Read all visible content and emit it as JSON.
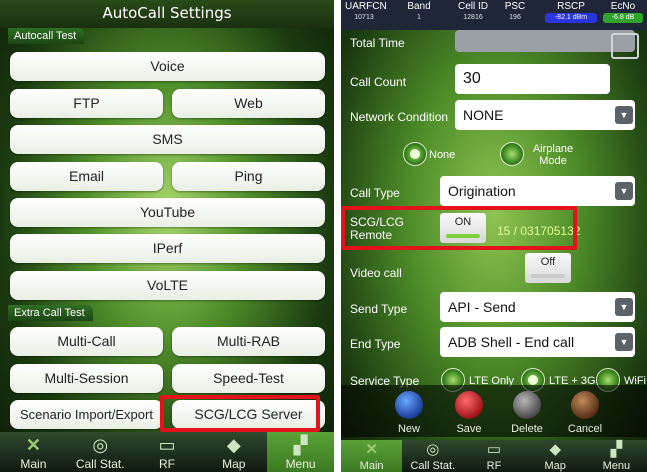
{
  "left": {
    "title": "AutoCall Settings",
    "sections": {
      "autocall_test": "Autocall Test",
      "extra_call_test": "Extra Call Test"
    },
    "buttons": {
      "voice": "Voice",
      "ftp": "FTP",
      "web": "Web",
      "sms": "SMS",
      "email": "Email",
      "ping": "Ping",
      "youtube": "YouTube",
      "iperf": "IPerf",
      "volte": "VoLTE",
      "multi_call": "Multi-Call",
      "multi_rab": "Multi-RAB",
      "multi_session": "Multi-Session",
      "speed_test": "Speed-Test",
      "scenario": "Scenario Import/Export",
      "scg_lcg_server": "SCG/LCG Server"
    },
    "nav": [
      {
        "label": "Main",
        "icon": "x-icon"
      },
      {
        "label": "Call Stat.",
        "icon": "call-stat-icon"
      },
      {
        "label": "RF",
        "icon": "rf-icon"
      },
      {
        "label": "Map",
        "icon": "map-icon"
      },
      {
        "label": "Menu",
        "icon": "menu-icon"
      }
    ]
  },
  "right": {
    "status": {
      "headers": [
        "UARFCN",
        "Band",
        "Cell ID",
        "PSC",
        "RSCP",
        "EcNo"
      ],
      "values": [
        "10713",
        "1",
        "12816",
        "196",
        "-82.1 dBm",
        "-6.8 dB"
      ],
      "rscp_color": "#2a35e0",
      "ecno_color": "#2ea52a"
    },
    "labels": {
      "total_time": "Total Time",
      "call_count": "Call Count",
      "network_condition": "Network Condition",
      "call_type": "Call Type",
      "scg_lcg_remote_1": "SCG/LCG",
      "scg_lcg_remote_2": "Remote",
      "video_call": "Video call",
      "send_type": "Send Type",
      "end_type": "End Type",
      "service_type": "Service Type"
    },
    "values": {
      "call_count": "30",
      "network_condition": "NONE",
      "call_type": "Origination",
      "send_type": "API - Send",
      "end_type": "ADB Shell - End call",
      "scg_number": "15 / 031705132",
      "scg_toggle": "ON",
      "video_toggle": "Off"
    },
    "radios": {
      "none": "None",
      "airplane_1": "Airplane",
      "airplane_2": "Mode",
      "lte_only": "LTE Only",
      "lte_3g": "LTE + 3G",
      "wifi": "WiFi"
    },
    "actions": [
      "New",
      "Save",
      "Delete",
      "Cancel"
    ],
    "nav": [
      {
        "label": "Main",
        "icon": "x-icon"
      },
      {
        "label": "Call Stat.",
        "icon": "call-stat-icon"
      },
      {
        "label": "RF",
        "icon": "rf-icon"
      },
      {
        "label": "Map",
        "icon": "map-icon"
      },
      {
        "label": "Menu",
        "icon": "menu-icon"
      }
    ]
  },
  "colors": {
    "highlight": "#e3121b",
    "accent": "#5aa237"
  }
}
